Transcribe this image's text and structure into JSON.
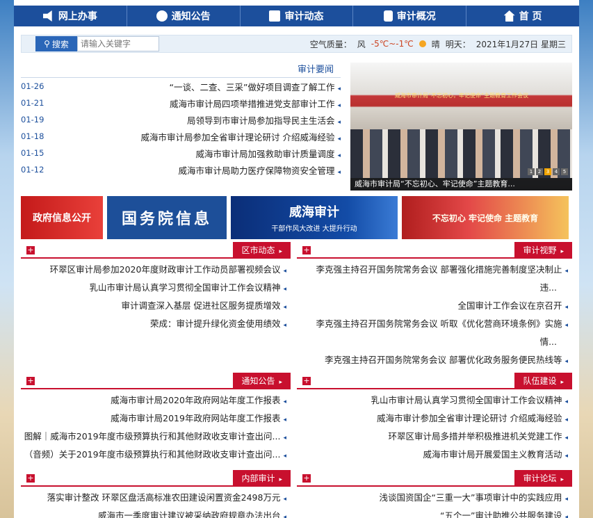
{
  "nav": [
    {
      "label": "网上办事",
      "icon": "speaker-icon"
    },
    {
      "label": "通知公告",
      "icon": "chat-icon"
    },
    {
      "label": "审计动态",
      "icon": "person-icon"
    },
    {
      "label": "审计概况",
      "icon": "document-icon"
    },
    {
      "label": "首 页",
      "icon": "home-icon"
    }
  ],
  "topbar": {
    "search_button": "搜索",
    "search_placeholder": "请输入关键字",
    "date": "2021年1月27日 星期三",
    "weather_prefix": "明天：",
    "weather_cond": "晴",
    "weather_temp": "-5℃~-1℃",
    "weather_wind": "风",
    "air_quality": "空气质量："
  },
  "news": {
    "title": "审计要闻",
    "photo_caption": "威海市审计局“不忘初心、牢记使命”主题教育...",
    "photo_banner": "威海市审计局“不忘初心，牢记使命”主题教育工作会议",
    "photo_pages": [
      "1",
      "2",
      "3",
      "4",
      "5"
    ],
    "items": [
      {
        "date": "01-26",
        "text": "“一谈、二查、三采”做好项目调查了解工作"
      },
      {
        "date": "01-21",
        "text": "威海市审计局四项举措推进党支部审计工作"
      },
      {
        "date": "01-19",
        "text": "局领导到市审计局参加指导民主生活会"
      },
      {
        "date": "01-18",
        "text": "威海市审计局参加全省审计理论研讨 介绍威海经验"
      },
      {
        "date": "01-15",
        "text": "威海市审计局加强救助审计质量调度"
      },
      {
        "date": "01-12",
        "text": "威海市审计局助力医疗保障物资安全管理"
      }
    ]
  },
  "banners": [
    {
      "text": "政府信息公开"
    },
    {
      "text": "国务院信息"
    },
    {
      "text": "威海审计",
      "sub": "干部作风大改进 大提升行动"
    },
    {
      "text": "不忘初心 牢记使命 主题教育"
    }
  ],
  "sections": {
    "qudong": {
      "label": "区市动态",
      "items": [
        "环翠区审计局参加2020年度财政审计工作动员部署视频会议",
        "乳山市审计局认真学习贯彻全国审计工作会议精神",
        "审计调查深入基层 促进社区服务提质增效",
        "荣成：审计提升绿化资金使用绩效"
      ]
    },
    "shiping": {
      "label": "审计视野",
      "items": [
        "李克强主持召开国务院常务会议 部署强化措施完善制度坚决制止",
        "违...",
        "全国审计工作会议在京召开",
        "李克强主持召开国务院常务会议 听取《优化营商环境条例》实施",
        "情...",
        "李克强主持召开国务院常务会议 部署优化政务服务便民热线等"
      ]
    },
    "tongzhi": {
      "label": "通知公告",
      "items": [
        "威海市审计局2020年政府网站年度工作报表",
        "威海市审计局2019年政府网站年度工作报表",
        "图解｜威海市2019年度市级预算执行和其他财政收支审计查出问...",
        "（音频）关于2019年度市级预算执行和其他财政收支审计查出问..."
      ]
    },
    "duiwu": {
      "label": "队伍建设",
      "items": [
        "乳山市审计局认真学习贯彻全国审计工作会议精神",
        "威海市审计参加全省审计理论研讨 介绍威海经验",
        "环翠区审计局多措并举积极推进机关党建工作",
        "威海市审计局开展爱国主义教育活动"
      ]
    },
    "neibu": {
      "label": "内部审计",
      "items": [
        "落实审计整改 环翠区盘活高标准农田建设闲置资金2498万元",
        "威海市一季度审计建议被采纳政府规章办法出台"
      ]
    },
    "luntan": {
      "label": "审计论坛",
      "items": [
        "浅谈国资国企“三重一大”事项审计中的实践应用",
        "“五个一”审计助推公共服务建设"
      ]
    }
  }
}
